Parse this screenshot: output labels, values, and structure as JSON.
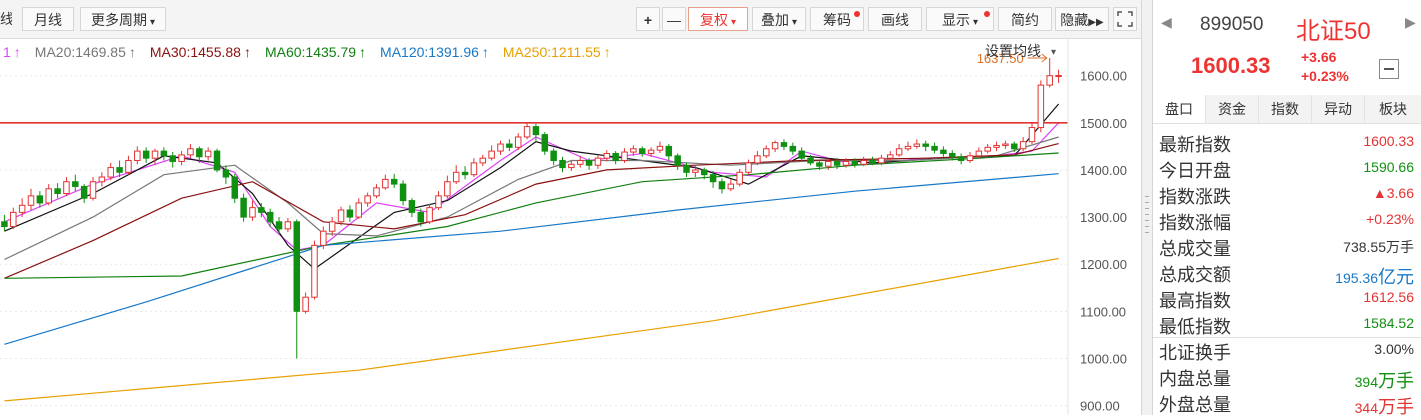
{
  "toolbar": {
    "left_cut": "线",
    "monthly": "月线",
    "more_periods": "更多周期",
    "zoom_in": "+",
    "zoom_out": "—",
    "restore": "复权",
    "overlay": "叠加",
    "chips": "筹码",
    "draw": "画线",
    "display": "显示",
    "simple": "简约",
    "hide": "隐藏",
    "colors": {
      "accent": "#e33333",
      "border": "#d6d6d6"
    }
  },
  "chart_data": {
    "type": "candlestick",
    "ma_labels": [
      {
        "text": "1",
        "color": "#e040fb"
      },
      {
        "text": "MA20:1469.85",
        "color": "#777777"
      },
      {
        "text": "MA30:1455.88",
        "color": "#8b1010"
      },
      {
        "text": "MA60:1435.79",
        "color": "#108010"
      },
      {
        "text": "MA120:1391.96",
        "color": "#1878c8"
      },
      {
        "text": "MA250:1211.55",
        "color": "#e8a000"
      }
    ],
    "ma_arrow": "↑",
    "settings_label": "设置均线",
    "ylim": [
      880,
      1680
    ],
    "y_ticks": [
      1600,
      1500,
      1400,
      1300,
      1200,
      1100,
      1000,
      900
    ],
    "y_tick_labels": [
      "1600.00",
      "1500.00",
      "1400.00",
      "1300.00",
      "1200.00",
      "1100.00",
      "1000.00",
      "900.00"
    ],
    "max_annotation": {
      "text": "1637.50",
      "value": 1637.5
    },
    "reference_line": 1500,
    "candles": [
      [
        1290,
        1280,
        1305,
        1270
      ],
      [
        1280,
        1310,
        1320,
        1275
      ],
      [
        1310,
        1325,
        1340,
        1300
      ],
      [
        1325,
        1345,
        1360,
        1315
      ],
      [
        1345,
        1330,
        1355,
        1320
      ],
      [
        1330,
        1360,
        1370,
        1325
      ],
      [
        1360,
        1350,
        1372,
        1340
      ],
      [
        1350,
        1375,
        1385,
        1345
      ],
      [
        1375,
        1365,
        1390,
        1355
      ],
      [
        1365,
        1340,
        1370,
        1330
      ],
      [
        1340,
        1375,
        1385,
        1335
      ],
      [
        1375,
        1385,
        1395,
        1365
      ],
      [
        1385,
        1405,
        1415,
        1378
      ],
      [
        1405,
        1395,
        1420,
        1385
      ],
      [
        1395,
        1420,
        1430,
        1390
      ],
      [
        1420,
        1440,
        1450,
        1412
      ],
      [
        1440,
        1425,
        1448,
        1415
      ],
      [
        1425,
        1440,
        1445,
        1410
      ],
      [
        1440,
        1430,
        1448,
        1420
      ],
      [
        1430,
        1418,
        1438,
        1405
      ],
      [
        1418,
        1432,
        1440,
        1410
      ],
      [
        1432,
        1445,
        1455,
        1425
      ],
      [
        1445,
        1428,
        1450,
        1415
      ],
      [
        1428,
        1440,
        1448,
        1420
      ],
      [
        1440,
        1400,
        1445,
        1395
      ],
      [
        1400,
        1385,
        1410,
        1370
      ],
      [
        1385,
        1340,
        1392,
        1330
      ],
      [
        1340,
        1300,
        1350,
        1290
      ],
      [
        1300,
        1320,
        1335,
        1292
      ],
      [
        1320,
        1310,
        1330,
        1300
      ],
      [
        1310,
        1290,
        1318,
        1280
      ],
      [
        1290,
        1275,
        1300,
        1265
      ],
      [
        1275,
        1290,
        1298,
        1268
      ],
      [
        1290,
        1100,
        1295,
        1000
      ],
      [
        1100,
        1130,
        1140,
        1095
      ],
      [
        1130,
        1240,
        1250,
        1125
      ],
      [
        1240,
        1270,
        1280,
        1232
      ],
      [
        1270,
        1290,
        1300,
        1260
      ],
      [
        1290,
        1315,
        1322,
        1282
      ],
      [
        1315,
        1300,
        1325,
        1290
      ],
      [
        1300,
        1330,
        1340,
        1296
      ],
      [
        1330,
        1345,
        1352,
        1322
      ],
      [
        1345,
        1362,
        1370,
        1340
      ],
      [
        1362,
        1380,
        1390,
        1358
      ],
      [
        1380,
        1370,
        1392,
        1362
      ],
      [
        1370,
        1335,
        1378,
        1325
      ],
      [
        1335,
        1310,
        1340,
        1300
      ],
      [
        1310,
        1290,
        1318,
        1280
      ],
      [
        1290,
        1320,
        1328,
        1285
      ],
      [
        1320,
        1345,
        1355,
        1315
      ],
      [
        1345,
        1375,
        1388,
        1340
      ],
      [
        1375,
        1395,
        1410,
        1370
      ],
      [
        1395,
        1390,
        1408,
        1380
      ],
      [
        1390,
        1415,
        1425,
        1385
      ],
      [
        1415,
        1425,
        1432,
        1408
      ],
      [
        1425,
        1440,
        1452,
        1420
      ],
      [
        1440,
        1455,
        1462,
        1432
      ],
      [
        1455,
        1448,
        1465,
        1440
      ],
      [
        1448,
        1470,
        1478,
        1442
      ],
      [
        1470,
        1492,
        1500,
        1465
      ],
      [
        1492,
        1475,
        1498,
        1462
      ],
      [
        1475,
        1440,
        1480,
        1432
      ],
      [
        1440,
        1420,
        1446,
        1410
      ],
      [
        1420,
        1405,
        1428,
        1395
      ],
      [
        1405,
        1412,
        1420,
        1398
      ],
      [
        1412,
        1420,
        1430,
        1405
      ],
      [
        1420,
        1410,
        1425,
        1400
      ],
      [
        1410,
        1425,
        1432,
        1402
      ],
      [
        1425,
        1435,
        1442,
        1418
      ],
      [
        1435,
        1420,
        1440,
        1412
      ],
      [
        1420,
        1438,
        1446,
        1415
      ],
      [
        1438,
        1445,
        1452,
        1430
      ],
      [
        1445,
        1435,
        1450,
        1428
      ],
      [
        1435,
        1442,
        1448,
        1428
      ],
      [
        1442,
        1450,
        1460,
        1436
      ],
      [
        1450,
        1430,
        1455,
        1420
      ],
      [
        1430,
        1410,
        1435,
        1400
      ],
      [
        1410,
        1395,
        1416,
        1385
      ],
      [
        1395,
        1400,
        1410,
        1385
      ],
      [
        1400,
        1390,
        1405,
        1380
      ],
      [
        1390,
        1375,
        1398,
        1362
      ],
      [
        1375,
        1360,
        1382,
        1350
      ],
      [
        1360,
        1370,
        1380,
        1355
      ],
      [
        1370,
        1395,
        1402,
        1365
      ],
      [
        1395,
        1415,
        1422,
        1390
      ],
      [
        1415,
        1430,
        1440,
        1410
      ],
      [
        1430,
        1445,
        1452,
        1425
      ],
      [
        1445,
        1458,
        1462,
        1438
      ],
      [
        1458,
        1450,
        1465,
        1442
      ],
      [
        1450,
        1440,
        1458,
        1432
      ],
      [
        1440,
        1425,
        1448,
        1418
      ],
      [
        1425,
        1415,
        1432,
        1410
      ],
      [
        1415,
        1408,
        1422,
        1400
      ],
      [
        1408,
        1418,
        1425,
        1400
      ],
      [
        1418,
        1410,
        1425,
        1402
      ],
      [
        1410,
        1418,
        1425,
        1405
      ],
      [
        1418,
        1412,
        1425,
        1405
      ],
      [
        1412,
        1420,
        1428,
        1408
      ],
      [
        1420,
        1415,
        1428,
        1410
      ],
      [
        1415,
        1425,
        1432,
        1410
      ],
      [
        1425,
        1432,
        1440,
        1420
      ],
      [
        1432,
        1445,
        1455,
        1428
      ],
      [
        1445,
        1450,
        1460,
        1440
      ],
      [
        1450,
        1455,
        1465,
        1445
      ],
      [
        1455,
        1450,
        1462,
        1440
      ],
      [
        1450,
        1442,
        1458,
        1435
      ],
      [
        1442,
        1435,
        1450,
        1428
      ],
      [
        1435,
        1428,
        1442,
        1420
      ],
      [
        1428,
        1420,
        1435,
        1412
      ],
      [
        1420,
        1430,
        1438,
        1415
      ],
      [
        1430,
        1440,
        1448,
        1425
      ],
      [
        1440,
        1448,
        1455,
        1435
      ],
      [
        1448,
        1452,
        1460,
        1440
      ],
      [
        1452,
        1455,
        1462,
        1445
      ],
      [
        1455,
        1445,
        1460,
        1438
      ],
      [
        1445,
        1460,
        1470,
        1440
      ],
      [
        1460,
        1490,
        1500,
        1455
      ],
      [
        1490,
        1580,
        1590,
        1480
      ],
      [
        1580,
        1600,
        1637.5,
        1575
      ],
      [
        1600,
        1600.33,
        1612.56,
        1584.52
      ]
    ],
    "moving_averages": [
      {
        "name": "MA5",
        "color": "#e040fb",
        "points": [
          [
            0,
            1290
          ],
          [
            10,
            1370
          ],
          [
            20,
            1430
          ],
          [
            26,
            1395
          ],
          [
            30,
            1280
          ],
          [
            33,
            1230
          ],
          [
            36,
            1240
          ],
          [
            42,
            1330
          ],
          [
            48,
            1310
          ],
          [
            56,
            1420
          ],
          [
            60,
            1470
          ],
          [
            66,
            1420
          ],
          [
            72,
            1435
          ],
          [
            80,
            1395
          ],
          [
            86,
            1385
          ],
          [
            90,
            1440
          ],
          [
            96,
            1410
          ],
          [
            104,
            1425
          ],
          [
            112,
            1430
          ],
          [
            116,
            1440
          ],
          [
            119,
            1500
          ]
        ]
      },
      {
        "name": "MA10",
        "color": "#111111",
        "points": [
          [
            0,
            1270
          ],
          [
            10,
            1350
          ],
          [
            18,
            1430
          ],
          [
            24,
            1415
          ],
          [
            28,
            1350
          ],
          [
            32,
            1240
          ],
          [
            35,
            1190
          ],
          [
            38,
            1230
          ],
          [
            44,
            1310
          ],
          [
            50,
            1335
          ],
          [
            56,
            1405
          ],
          [
            60,
            1460
          ],
          [
            64,
            1440
          ],
          [
            70,
            1425
          ],
          [
            78,
            1405
          ],
          [
            84,
            1370
          ],
          [
            90,
            1430
          ],
          [
            98,
            1415
          ],
          [
            106,
            1425
          ],
          [
            114,
            1430
          ],
          [
            119,
            1540
          ]
        ]
      },
      {
        "name": "MA20",
        "color": "#777777",
        "points": [
          [
            0,
            1210
          ],
          [
            10,
            1300
          ],
          [
            18,
            1390
          ],
          [
            26,
            1410
          ],
          [
            32,
            1330
          ],
          [
            36,
            1265
          ],
          [
            42,
            1260
          ],
          [
            50,
            1300
          ],
          [
            58,
            1380
          ],
          [
            64,
            1420
          ],
          [
            72,
            1420
          ],
          [
            82,
            1410
          ],
          [
            92,
            1420
          ],
          [
            102,
            1420
          ],
          [
            112,
            1430
          ],
          [
            119,
            1470
          ]
        ]
      },
      {
        "name": "MA30",
        "color": "#8b1010",
        "points": [
          [
            0,
            1170
          ],
          [
            10,
            1250
          ],
          [
            20,
            1340
          ],
          [
            28,
            1375
          ],
          [
            36,
            1290
          ],
          [
            44,
            1275
          ],
          [
            52,
            1305
          ],
          [
            60,
            1370
          ],
          [
            68,
            1400
          ],
          [
            78,
            1410
          ],
          [
            90,
            1420
          ],
          [
            104,
            1425
          ],
          [
            114,
            1432
          ],
          [
            119,
            1456
          ]
        ]
      },
      {
        "name": "MA60",
        "color": "#108010",
        "points": [
          [
            0,
            1170
          ],
          [
            20,
            1175
          ],
          [
            36,
            1240
          ],
          [
            50,
            1280
          ],
          [
            60,
            1330
          ],
          [
            72,
            1375
          ],
          [
            84,
            1390
          ],
          [
            96,
            1410
          ],
          [
            110,
            1425
          ],
          [
            119,
            1436
          ]
        ]
      },
      {
        "name": "MA120",
        "color": "#1878c8",
        "points": [
          [
            0,
            1030
          ],
          [
            16,
            1120
          ],
          [
            36,
            1240
          ],
          [
            56,
            1270
          ],
          [
            76,
            1315
          ],
          [
            96,
            1355
          ],
          [
            119,
            1392
          ]
        ]
      },
      {
        "name": "MA250",
        "color": "#e8a000",
        "points": [
          [
            0,
            910
          ],
          [
            40,
            975
          ],
          [
            80,
            1080
          ],
          [
            119,
            1212
          ]
        ]
      }
    ]
  },
  "panel": {
    "nav_prev": "◀",
    "nav_next": "▶",
    "code": "899050",
    "name": "北证50",
    "price": "1600.33",
    "change": "+3.66",
    "change_pct": "+0.23%",
    "tabs": [
      "盘口",
      "资金",
      "指数",
      "异动",
      "板块"
    ],
    "rows": [
      {
        "label": "最新指数",
        "value": "1600.33",
        "color": "#e33333"
      },
      {
        "label": "今日开盘",
        "value": "1590.66",
        "color": "#109010"
      },
      {
        "label": "指数涨跌",
        "value": "▲3.66",
        "color": "#e33333"
      },
      {
        "label": "指数涨幅",
        "value": "+0.23%",
        "color": "#e33333"
      },
      {
        "label": "总成交量",
        "value": "738.55万手",
        "color": "#333333"
      },
      {
        "label": "总成交额",
        "value": "195.36",
        "unit": "亿元",
        "color": "#1878c8"
      },
      {
        "label": "最高指数",
        "value": "1612.56",
        "color": "#e33333"
      },
      {
        "label": "最低指数",
        "value": "1584.52",
        "color": "#109010"
      },
      {
        "label": "北证换手",
        "value": "3.00%",
        "color": "#333333"
      },
      {
        "label": "内盘总量",
        "value": "394",
        "unit": "万手",
        "color": "#109010"
      },
      {
        "label": "外盘总量",
        "value": "344",
        "unit": "万手",
        "color": "#e33333"
      }
    ]
  }
}
